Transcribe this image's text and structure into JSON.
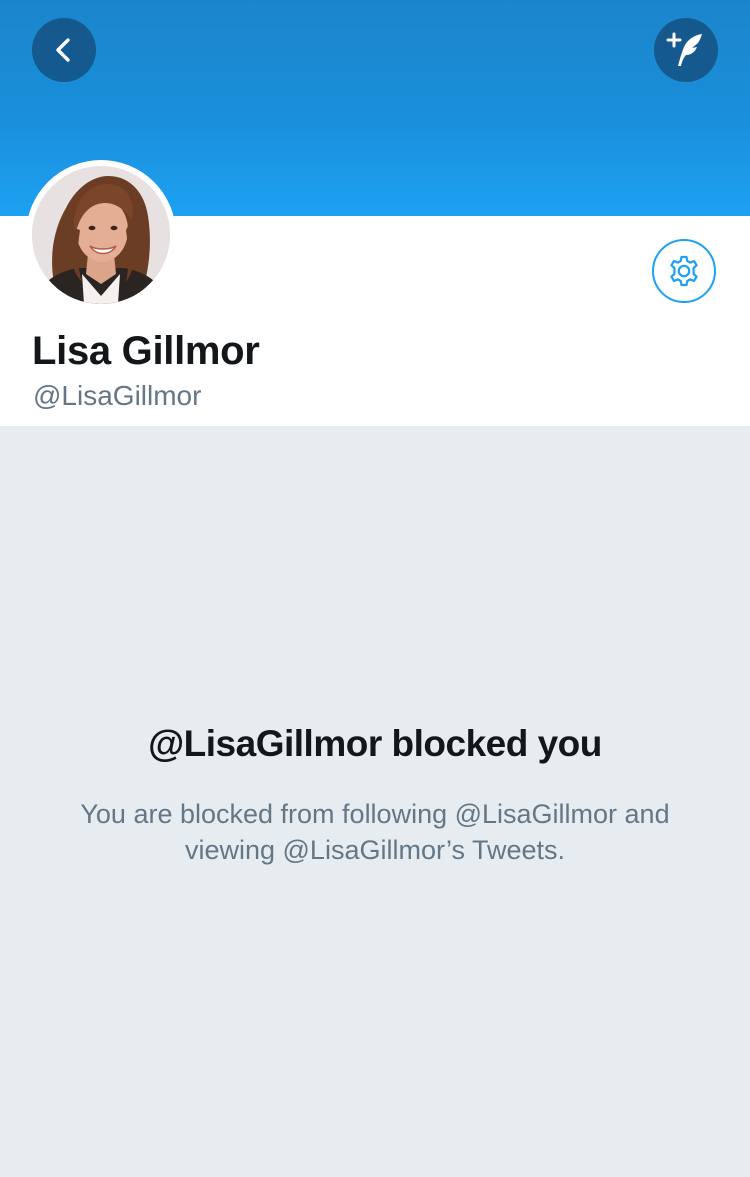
{
  "header": {
    "back_icon": "chevron-left-icon",
    "compose_icon": "compose-tweet-quill-icon",
    "banner_color": "#1da1f2"
  },
  "profile": {
    "display_name": "Lisa Gillmor",
    "handle": "@LisaGillmor",
    "avatar_icon": "profile-photo",
    "settings_icon": "gear-icon"
  },
  "blocked": {
    "title": "@LisaGillmor blocked you",
    "message": "You are blocked from following @LisaGillmor and viewing @LisaGillmor’s Tweets."
  },
  "colors": {
    "accent": "#1da1f2",
    "background": "#e6ecf0",
    "primary_text": "#14171a",
    "secondary_text": "#657786"
  }
}
